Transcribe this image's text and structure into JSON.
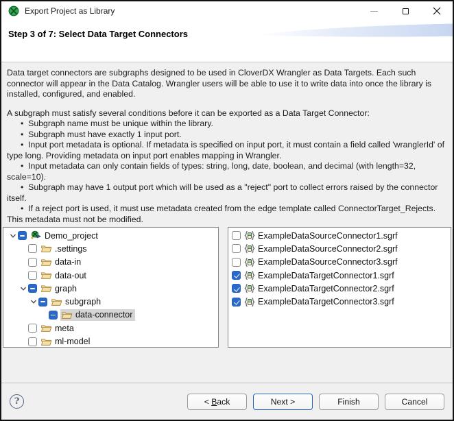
{
  "window": {
    "title": "Export Project as Library",
    "app_icon": "cloverdx-logo",
    "controls": [
      "minimize",
      "maximize",
      "close"
    ]
  },
  "banner": {
    "step_title": "Step 3 of 7: Select Data Target Connectors"
  },
  "description": {
    "intro": "Data target connectors are subgraphs designed to be used in CloverDX Wrangler as Data Targets. Each such connector will appear in the Data Catalog. Wrangler users will be able to use it to write data into once the library is installed, configured, and enabled.",
    "conditions_intro": "A subgraph must satisfy several conditions before it can be exported as a Data Target Connector:",
    "bullet_char": "•",
    "bullets": [
      "Subgraph name must be unique within the library.",
      "Subgraph must have exactly 1 input port.",
      "Input port metadata is optional. If metadata is specified on input port, it must contain a field called 'wranglerId' of type long. Providing metadata on input port enables mapping in Wrangler.",
      "Input metadata can only contain fields of types: string, long, date, boolean, and decimal (with length=32, scale=10).",
      "Subgraph may have 1 output port which will be used as a \"reject\" port to collect errors raised by the connector itself.",
      "If a reject port is used, it must use metadata created from the edge template called ConnectorTarget_Rejects. This metadata must not be modified."
    ]
  },
  "tree": {
    "items": [
      {
        "label": "Demo_project",
        "depth": 0,
        "expanded": true,
        "checkbox": "partial",
        "icon": "project",
        "selected": false
      },
      {
        "label": ".settings",
        "depth": 1,
        "expanded": false,
        "checkbox": "unchecked",
        "icon": "folder",
        "selected": false
      },
      {
        "label": "data-in",
        "depth": 1,
        "expanded": false,
        "checkbox": "unchecked",
        "icon": "folder",
        "selected": false
      },
      {
        "label": "data-out",
        "depth": 1,
        "expanded": false,
        "checkbox": "unchecked",
        "icon": "folder",
        "selected": false
      },
      {
        "label": "graph",
        "depth": 1,
        "expanded": true,
        "checkbox": "partial",
        "icon": "folder",
        "selected": false
      },
      {
        "label": "subgraph",
        "depth": 2,
        "expanded": true,
        "checkbox": "partial",
        "icon": "folder",
        "selected": false
      },
      {
        "label": "data-connector",
        "depth": 3,
        "expanded": false,
        "checkbox": "partial",
        "icon": "folder",
        "selected": true
      },
      {
        "label": "meta",
        "depth": 1,
        "expanded": false,
        "checkbox": "unchecked",
        "icon": "folder",
        "selected": false
      },
      {
        "label": "ml-model",
        "depth": 1,
        "expanded": false,
        "checkbox": "unchecked",
        "icon": "folder",
        "selected": false
      }
    ]
  },
  "file_list": {
    "items": [
      {
        "label": "ExampleDataSourceConnector1.sgrf",
        "checked": false,
        "icon": "subgraph-file"
      },
      {
        "label": "ExampleDataSourceConnector2.sgrf",
        "checked": false,
        "icon": "subgraph-file"
      },
      {
        "label": "ExampleDataSourceConnector3.sgrf",
        "checked": false,
        "icon": "subgraph-file"
      },
      {
        "label": "ExampleDataTargetConnector1.sgrf",
        "checked": true,
        "icon": "subgraph-file"
      },
      {
        "label": "ExampleDataTargetConnector2.sgrf",
        "checked": true,
        "icon": "subgraph-file"
      },
      {
        "label": "ExampleDataTargetConnector3.sgrf",
        "checked": true,
        "icon": "subgraph-file"
      }
    ]
  },
  "footer": {
    "help_glyph": "?",
    "buttons": [
      {
        "name": "back-button",
        "label_pre": "< ",
        "label_key": "B",
        "label_post": "ack",
        "default": false
      },
      {
        "name": "next-button",
        "label_pre": "",
        "label_key": "",
        "label_post": "Next >",
        "default": true
      },
      {
        "name": "finish-button",
        "label_pre": "",
        "label_key": "",
        "label_post": "Finish",
        "default": false
      },
      {
        "name": "cancel-button",
        "label_pre": "",
        "label_key": "",
        "label_post": "Cancel",
        "default": false
      }
    ]
  },
  "colors": {
    "accent_checkbox_blue": "#2a69c9",
    "selection_gray": "#d5d5d5",
    "banner_swoosh_blue": "#c7d6f0",
    "folder_fill": "#f3dfa8",
    "clover_green": "#2ba84a"
  }
}
